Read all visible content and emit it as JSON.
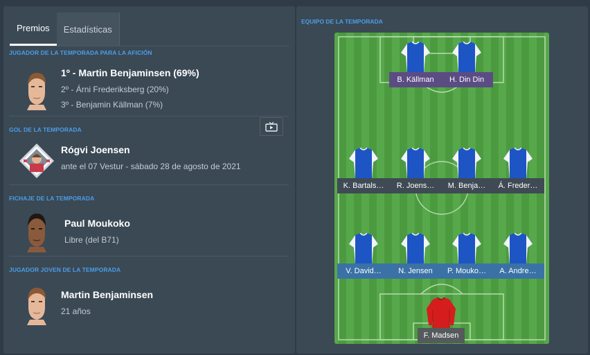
{
  "tabs": {
    "awards": "Premios",
    "stats": "Estadísticas"
  },
  "fans_player": {
    "title": "JUGADOR DE LA TEMPORADA PARA LA AFICIÓN",
    "first": "1º - Martin Benjaminsen (69%)",
    "second": "2º - Árni Frederiksberg (20%)",
    "third": "3º - Benjamin Källman (7%)"
  },
  "goal": {
    "title": "GOL DE LA TEMPORADA",
    "player": "Rógvi Joensen",
    "detail": "ante el 07 Vestur - sábado 28 de agosto de 2021",
    "video_icon": "tv-play-icon"
  },
  "signing": {
    "title": "FICHAJE DE LA TEMPORADA",
    "player": "Paul Moukoko",
    "detail": "Libre (del B71)"
  },
  "young": {
    "title": "JUGADOR JOVEN DE LA TEMPORADA",
    "player": "Martin Benjaminsen",
    "detail": "21 años"
  },
  "team": {
    "title": "EQUIPO DE LA TEMPORADA",
    "forwards": [
      "B. Källman",
      "H. Din Din"
    ],
    "midfield": [
      "K. Bartals…",
      "R. Joens…",
      "M. Benja…",
      "Á. Freder…"
    ],
    "defence": [
      "V. David…",
      "N. Jensen",
      "P. Mouko…",
      "A. Andre…"
    ],
    "goalkeeper": "F. Madsen"
  },
  "colors": {
    "accent": "#4a9ee8",
    "pitch_light": "#57a84a",
    "pitch_dark": "#4c9a40",
    "forward_tag": "#5b4c84",
    "midfield_tag": "#3f4a55",
    "defence_tag": "#3b72a6",
    "keeper_tag": "#555a5c",
    "shirt_blue": "#1d55c4",
    "shirt_red": "#d61d1d"
  }
}
